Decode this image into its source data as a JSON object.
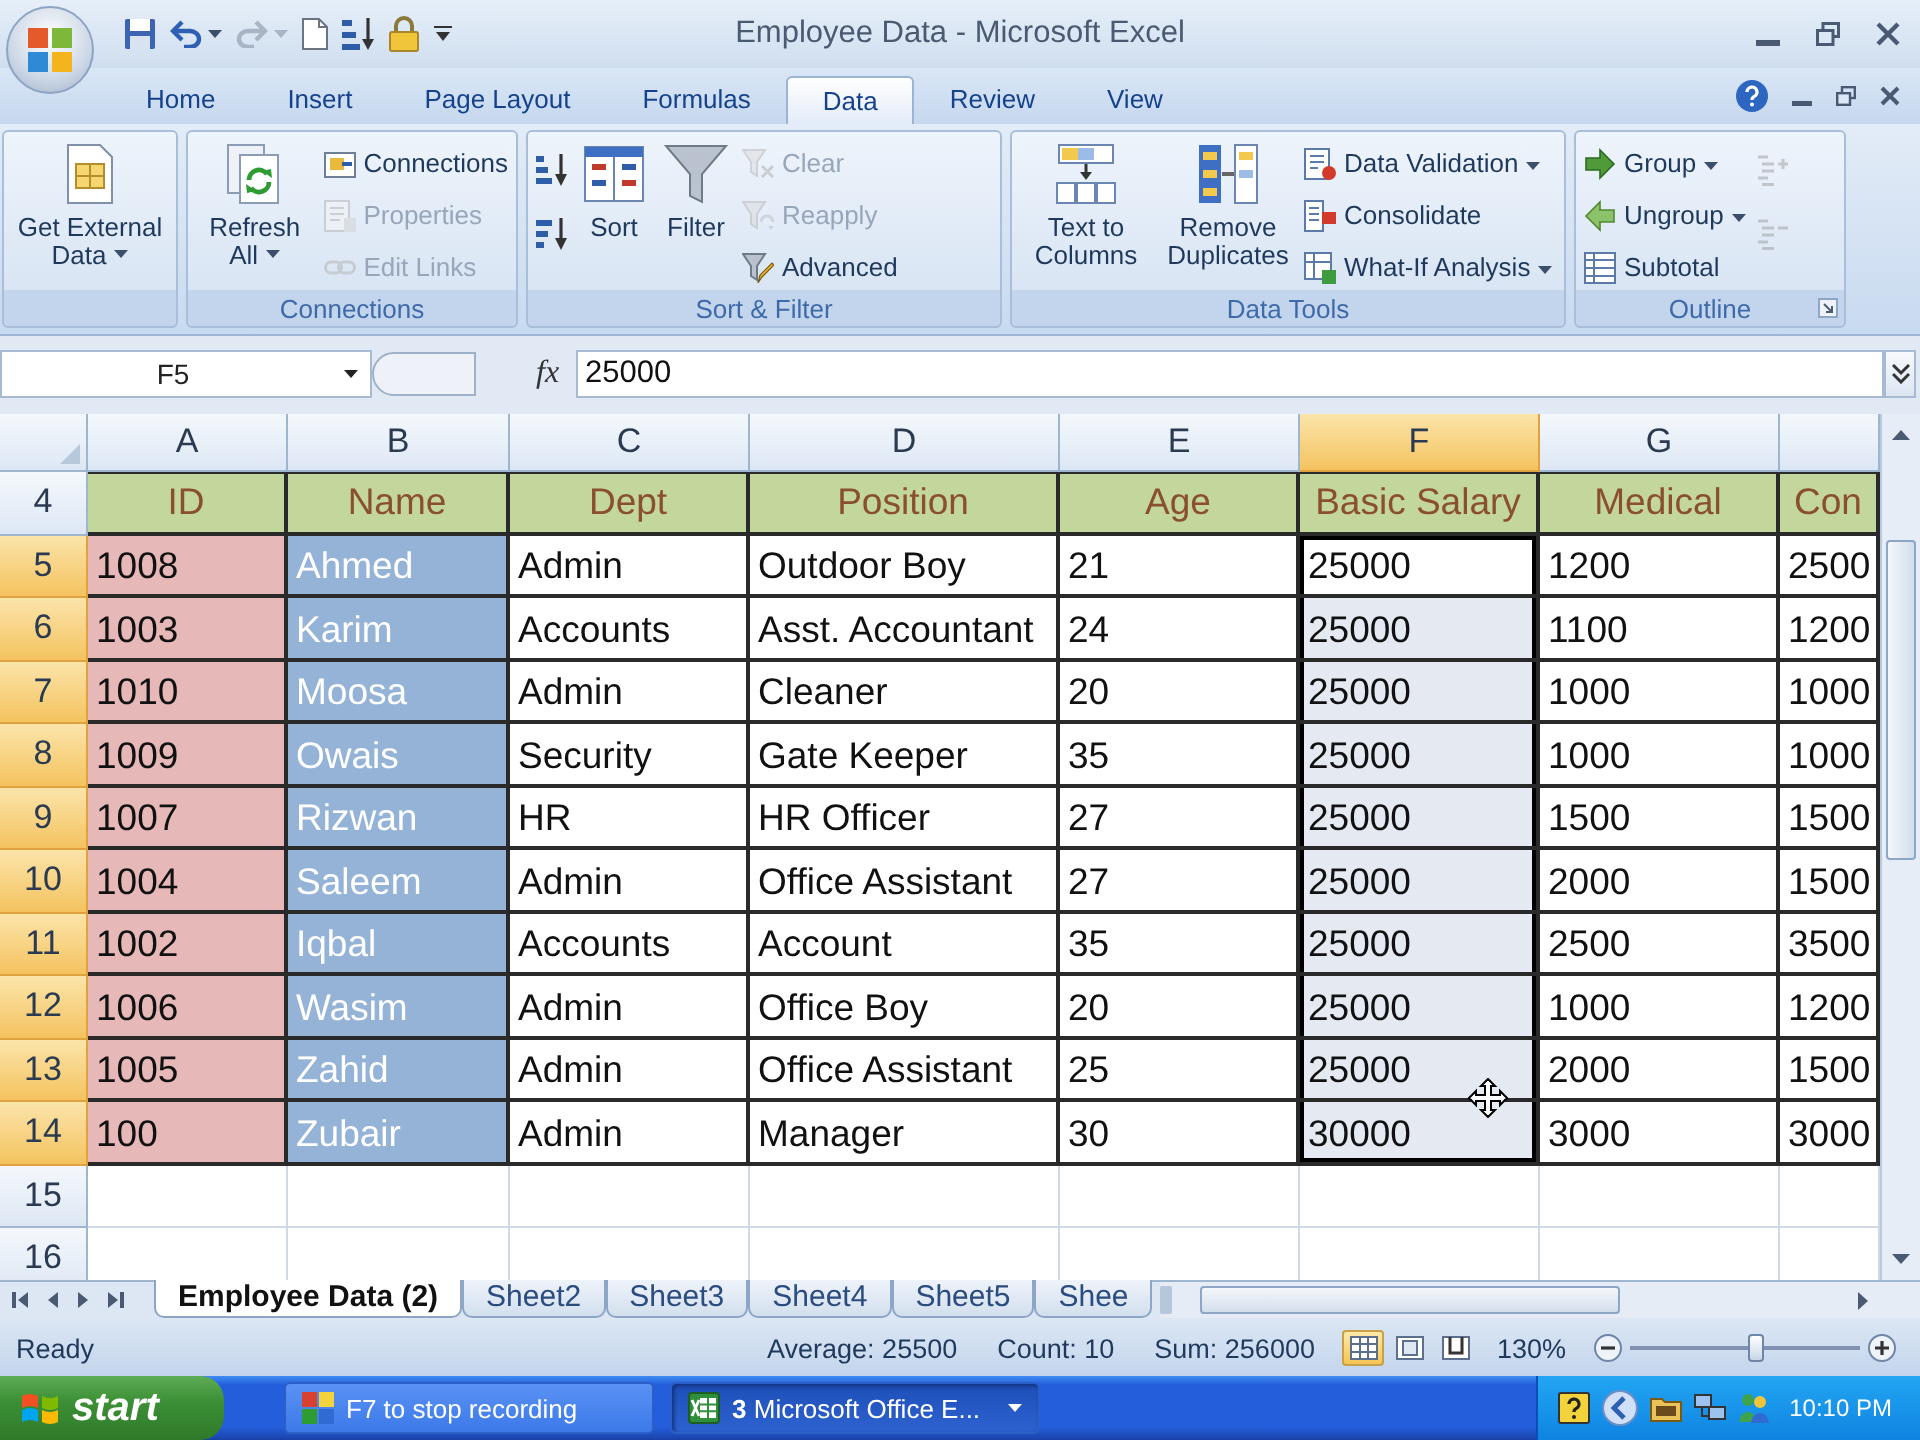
{
  "window": {
    "title": "Employee Data - Microsoft Excel"
  },
  "ribbon_tabs": [
    {
      "label": "Home",
      "selected": false
    },
    {
      "label": "Insert",
      "selected": false
    },
    {
      "label": "Page Layout",
      "selected": false
    },
    {
      "label": "Formulas",
      "selected": false
    },
    {
      "label": "Data",
      "selected": true
    },
    {
      "label": "Review",
      "selected": false
    },
    {
      "label": "View",
      "selected": false
    }
  ],
  "ribbon_groups": [
    {
      "kind": "external",
      "launcher": false,
      "items": [
        {
          "kind": "large",
          "label": "Get External Data",
          "dropdown": true,
          "disabled": false
        }
      ]
    },
    {
      "kind": "connections",
      "label": "Connections",
      "launcher": false,
      "items": [
        {
          "kind": "large",
          "label": "Refresh All",
          "dropdown": true,
          "disabled": false
        },
        {
          "kind": "small",
          "label": "Connections",
          "dropdown": false,
          "disabled": false
        },
        {
          "kind": "small",
          "label": "Properties",
          "dropdown": false,
          "disabled": true
        },
        {
          "kind": "small",
          "label": "Edit Links",
          "dropdown": false,
          "disabled": true
        }
      ]
    },
    {
      "kind": "sort_filter",
      "label": "Sort & Filter",
      "launcher": false,
      "items": [
        {
          "kind": "icon",
          "dropdown": false,
          "disabled": false
        },
        {
          "kind": "icon",
          "dropdown": false,
          "disabled": false
        },
        {
          "kind": "large",
          "label": "Sort",
          "dropdown": false,
          "disabled": false
        },
        {
          "kind": "large",
          "label": "Filter",
          "dropdown": false,
          "disabled": false
        },
        {
          "kind": "small",
          "label": "Clear",
          "dropdown": false,
          "disabled": true
        },
        {
          "kind": "small",
          "label": "Reapply",
          "dropdown": false,
          "disabled": true
        },
        {
          "kind": "small",
          "label": "Advanced",
          "dropdown": false,
          "disabled": false
        }
      ]
    },
    {
      "kind": "data_tools",
      "label": "Data Tools",
      "launcher": false,
      "items": [
        {
          "kind": "large",
          "label": "Text to Columns",
          "dropdown": false,
          "disabled": false
        },
        {
          "kind": "large",
          "label": "Remove Duplicates",
          "dropdown": false,
          "disabled": false
        },
        {
          "kind": "small",
          "label": "Data Validation",
          "dropdown": true,
          "disabled": false
        },
        {
          "kind": "small",
          "label": "Consolidate",
          "dropdown": false,
          "disabled": false
        },
        {
          "kind": "small",
          "label": "What-If Analysis",
          "dropdown": true,
          "disabled": false
        }
      ]
    },
    {
      "kind": "outline",
      "label": "Outline",
      "launcher": true,
      "items": [
        {
          "kind": "small",
          "label": "Group",
          "dropdown": true,
          "disabled": false
        },
        {
          "kind": "small",
          "label": "Ungroup",
          "dropdown": true,
          "disabled": false
        },
        {
          "kind": "small",
          "label": "Subtotal",
          "dropdown": false,
          "disabled": false
        },
        {
          "kind": "icon",
          "dropdown": false,
          "disabled": true
        },
        {
          "kind": "icon",
          "dropdown": false,
          "disabled": true
        }
      ]
    }
  ],
  "formula_bar": {
    "name_box": "F5",
    "function_button": "fx",
    "value": "25000"
  },
  "sheet": {
    "columns": [
      {
        "letter": "A",
        "selected": false,
        "color": "#e6b8b7"
      },
      {
        "letter": "B",
        "selected": false,
        "color": "#95b3d7"
      },
      {
        "letter": "C",
        "selected": false
      },
      {
        "letter": "D",
        "selected": false
      },
      {
        "letter": "E",
        "selected": false
      },
      {
        "letter": "F",
        "selected": true
      },
      {
        "letter": "G",
        "selected": false
      }
    ],
    "rows": [
      {
        "number": "4",
        "kind": "header",
        "selected": false,
        "cells": [
          "ID",
          "Name",
          "Dept",
          "Position",
          "Age",
          "Basic Salary",
          "Medical",
          "Con"
        ]
      },
      {
        "number": "5",
        "kind": "data",
        "selected": true,
        "cells": [
          "1008",
          "Ahmed",
          "Admin",
          "Outdoor Boy",
          "21",
          "25000",
          "1200",
          "2500"
        ]
      },
      {
        "number": "6",
        "kind": "data",
        "selected": true,
        "cells": [
          "1003",
          "Karim",
          "Accounts",
          "Asst. Accountant",
          "24",
          "25000",
          "1100",
          "1200"
        ]
      },
      {
        "number": "7",
        "kind": "data",
        "selected": true,
        "cells": [
          "1010",
          "Moosa",
          "Admin",
          "Cleaner",
          "20",
          "25000",
          "1000",
          "1000"
        ]
      },
      {
        "number": "8",
        "kind": "data",
        "selected": true,
        "cells": [
          "1009",
          "Owais",
          "Security",
          "Gate Keeper",
          "35",
          "25000",
          "1000",
          "1000"
        ]
      },
      {
        "number": "9",
        "kind": "data",
        "selected": true,
        "cells": [
          "1007",
          "Rizwan",
          "HR",
          "HR Officer",
          "27",
          "25000",
          "1500",
          "1500"
        ]
      },
      {
        "number": "10",
        "kind": "data",
        "selected": true,
        "cells": [
          "1004",
          "Saleem",
          "Admin",
          "Office Assistant",
          "27",
          "25000",
          "2000",
          "1500"
        ]
      },
      {
        "number": "11",
        "kind": "data",
        "selected": true,
        "cells": [
          "1002",
          "Iqbal",
          "Accounts",
          "Account",
          "35",
          "25000",
          "2500",
          "3500"
        ]
      },
      {
        "number": "12",
        "kind": "data",
        "selected": true,
        "cells": [
          "1006",
          "Wasim",
          "Admin",
          "Office Boy",
          "20",
          "25000",
          "1000",
          "1200"
        ]
      },
      {
        "number": "13",
        "kind": "data",
        "selected": true,
        "cells": [
          "1005",
          "Zahid",
          "Admin",
          "Office Assistant",
          "25",
          "25000",
          "2000",
          "1500"
        ]
      },
      {
        "number": "14",
        "kind": "data",
        "selected": true,
        "cells": [
          "100",
          "Zubair",
          "Admin",
          "Manager",
          "30",
          "30000",
          "3000",
          "3000"
        ]
      },
      {
        "number": "15",
        "kind": "empty",
        "selected": false
      },
      {
        "number": "16",
        "kind": "empty",
        "selected": false
      }
    ]
  },
  "sheet_tabs": [
    {
      "label": "Employee Data (2)",
      "selected": true
    },
    {
      "label": "Sheet2",
      "selected": false
    },
    {
      "label": "Sheet3",
      "selected": false
    },
    {
      "label": "Sheet4",
      "selected": false
    },
    {
      "label": "Sheet5",
      "selected": false
    },
    {
      "label": "Shee",
      "selected": false
    }
  ],
  "status_bar": {
    "mode": "Ready",
    "summaries": [
      "Average: 25500",
      "Count: 10",
      "Sum: 256000"
    ],
    "views": [
      {
        "selected": true
      },
      {
        "selected": false
      },
      {
        "selected": false
      }
    ],
    "zoom": "130%",
    "zoom_slider": {
      "level": 0.55
    }
  },
  "taskbar": {
    "start_label": "start",
    "tasks": [
      {
        "label": "F7 to stop recording",
        "selected": false,
        "dropdown": false
      },
      {
        "count": "3",
        "label": "Microsoft Office E...",
        "selected": true,
        "dropdown": true
      }
    ],
    "clock": "10:10 PM"
  }
}
